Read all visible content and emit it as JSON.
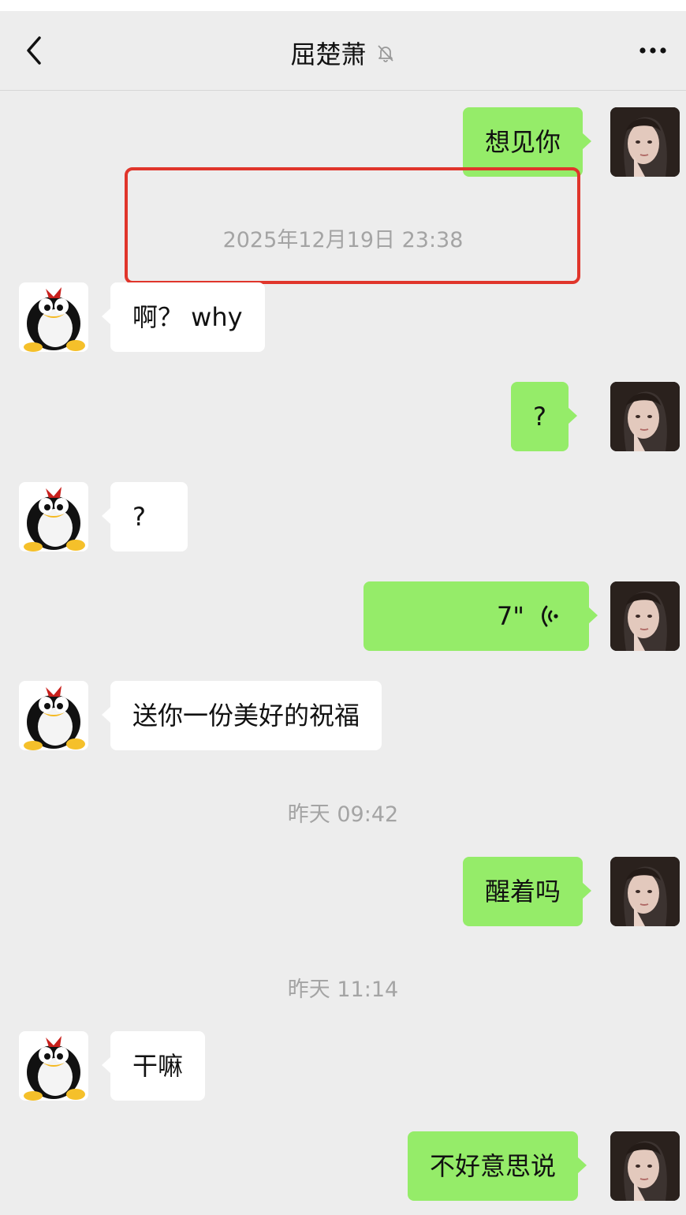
{
  "header": {
    "title": "屈楚萧"
  },
  "timestamps": {
    "t1": "2025年12月19日 23:38",
    "t2": "昨天 09:42",
    "t3": "昨天 11:14"
  },
  "messages": [
    {
      "from": "self",
      "text": "想见你"
    },
    {
      "from": "other",
      "text": "啊？ why"
    },
    {
      "from": "self",
      "text": "?"
    },
    {
      "from": "other",
      "text": "?"
    },
    {
      "from": "self",
      "type": "voice",
      "text": "7\""
    },
    {
      "from": "other",
      "text": "送你一份美好的祝福"
    },
    {
      "from": "self",
      "text": "醒着吗"
    },
    {
      "from": "other",
      "text": "干嘛"
    },
    {
      "from": "self",
      "text": "不好意思说"
    }
  ],
  "colors": {
    "background": "#ededed",
    "self_bubble": "#95ec69",
    "other_bubble": "#ffffff",
    "highlight": "#e0352b"
  },
  "icons": {
    "back": "chevron-left-icon",
    "mute": "bell-off-icon",
    "more": "more-dots-icon",
    "voice": "voice-wave-icon"
  }
}
